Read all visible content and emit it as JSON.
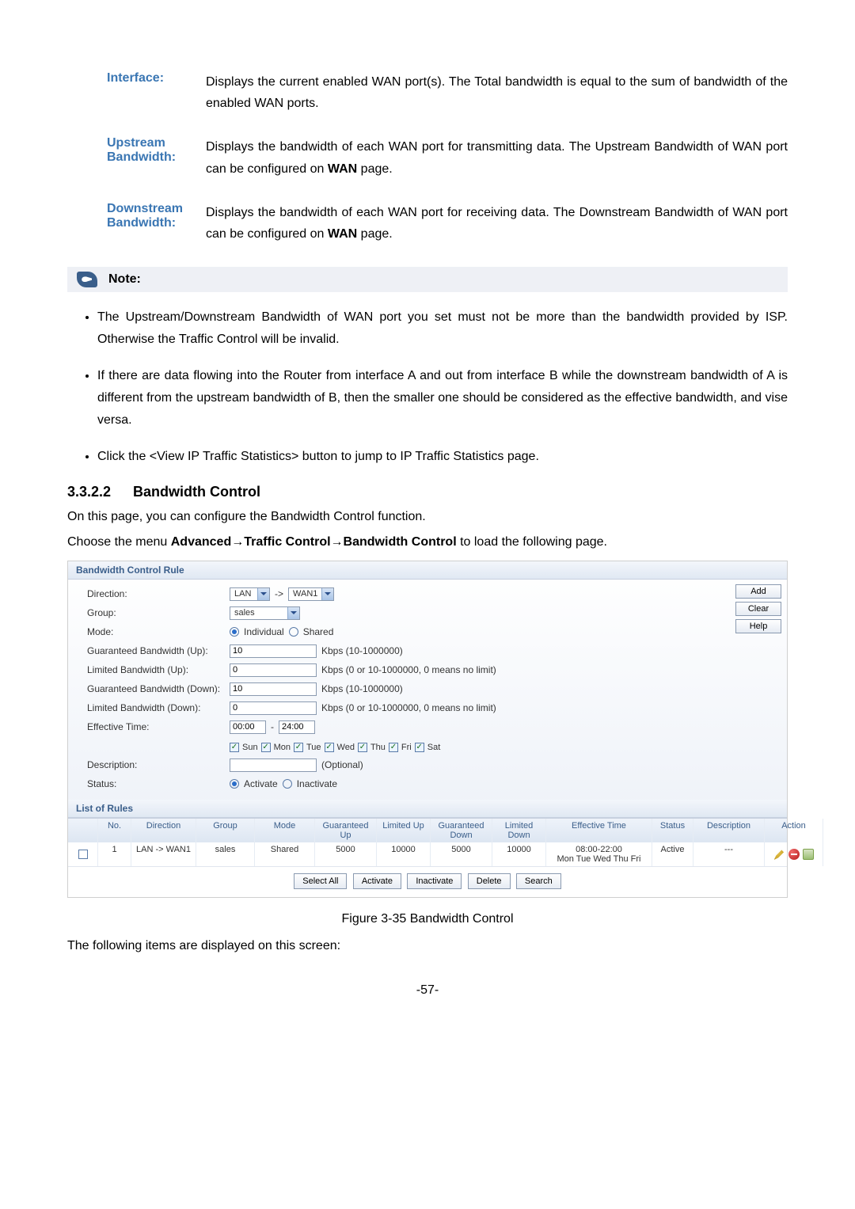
{
  "defs": {
    "interface": {
      "label": "Interface:",
      "body_a": "Displays the current enabled WAN port(s). The Total bandwidth is equal to the sum of bandwidth of the enabled WAN ports."
    },
    "upstream": {
      "label1": "Upstream",
      "label2": "Bandwidth:",
      "body_start": "Displays the bandwidth of each WAN port for transmitting data. The Upstream Bandwidth of WAN port can be configured on ",
      "body_bold": "WAN",
      "body_end": " page."
    },
    "downstream": {
      "label1": "Downstream",
      "label2": "Bandwidth:",
      "body_start": "Displays the bandwidth of each WAN port for receiving data. The Downstream Bandwidth of WAN port can be configured on ",
      "body_bold": "WAN",
      "body_end": " page."
    }
  },
  "note_title": "Note:",
  "notes": {
    "n1": "The Upstream/Downstream Bandwidth of WAN port you set must not be more than the bandwidth provided by ISP. Otherwise the Traffic Control will be invalid.",
    "n2": "If there are data flowing into the Router from interface A and out from interface B while the downstream bandwidth of A is different from the upstream bandwidth of B, then the smaller one should be considered as the effective bandwidth, and vise versa.",
    "n3": "Click the <View IP Traffic Statistics> button to jump to IP Traffic Statistics page."
  },
  "section": {
    "num": "3.3.2.2",
    "title": "Bandwidth Control"
  },
  "intro1": "On this page, you can configure the Bandwidth Control function.",
  "intro2_a": "Choose the menu ",
  "intro2_b": "Advanced→Traffic Control→Bandwidth Control",
  "intro2_c": " to load the following page.",
  "ui": {
    "panel1": "Bandwidth Control Rule",
    "buttons": {
      "add": "Add",
      "clear": "Clear",
      "help": "Help"
    },
    "labels": {
      "direction": "Direction:",
      "group": "Group:",
      "mode": "Mode:",
      "gbu": "Guaranteed Bandwidth (Up):",
      "lbu": "Limited Bandwidth (Up):",
      "gbd": "Guaranteed Bandwidth (Down):",
      "lbd": "Limited Bandwidth (Down):",
      "eff": "Effective Time:",
      "desc": "Description:",
      "status": "Status:"
    },
    "values": {
      "dir_from": "LAN",
      "arrow": "->",
      "dir_to": "WAN1",
      "group": "sales",
      "mode_opt1": "Individual",
      "mode_opt2": "Shared",
      "gbu": "10",
      "gbu_hint": "Kbps (10-1000000)",
      "lbu": "0",
      "lbu_hint": "Kbps (0 or 10-1000000, 0 means no limit)",
      "gbd": "10",
      "gbd_hint": "Kbps (10-1000000)",
      "lbd": "0",
      "lbd_hint": "Kbps (0 or 10-1000000, 0 means no limit)",
      "eff_from": "00:00",
      "eff_sep": "-",
      "eff_to": "24:00",
      "days": {
        "sun": "Sun",
        "mon": "Mon",
        "tue": "Tue",
        "wed": "Wed",
        "thu": "Thu",
        "fri": "Fri",
        "sat": "Sat"
      },
      "desc_hint": "(Optional)",
      "status_opt1": "Activate",
      "status_opt2": "Inactivate"
    },
    "panel2": "List of Rules",
    "cols": {
      "no": "No.",
      "dir": "Direction",
      "group": "Group",
      "mode": "Mode",
      "gup": "Guaranteed Up",
      "lup": "Limited Up",
      "gdn": "Guaranteed Down",
      "ldn": "Limited Down",
      "et": "Effective Time",
      "st": "Status",
      "desc": "Description",
      "act": "Action"
    },
    "row1": {
      "no": "1",
      "dir": "LAN -> WAN1",
      "group": "sales",
      "mode": "Shared",
      "gup": "5000",
      "lup": "10000",
      "gdn": "5000",
      "ldn": "10000",
      "et_time": "08:00-22:00",
      "et_days": "Mon Tue Wed Thu Fri",
      "st": "Active",
      "desc": "---"
    },
    "tbl_btns": {
      "selall": "Select All",
      "activate": "Activate",
      "inactivate": "Inactivate",
      "delete": "Delete",
      "search": "Search"
    }
  },
  "figcap": "Figure 3-35 Bandwidth Control",
  "closing": "The following items are displayed on this screen:",
  "pgnum": "-57-"
}
